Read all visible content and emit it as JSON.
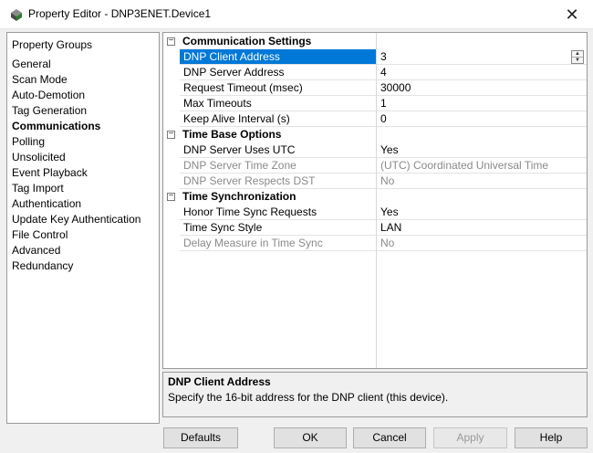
{
  "window": {
    "title": "Property Editor - DNP3ENET.Device1",
    "close_glyph": "✕"
  },
  "left_pane": {
    "header": "Property Groups",
    "items": [
      {
        "label": "General",
        "selected": false
      },
      {
        "label": "Scan Mode",
        "selected": false
      },
      {
        "label": "Auto-Demotion",
        "selected": false
      },
      {
        "label": "Tag Generation",
        "selected": false
      },
      {
        "label": "Communications",
        "selected": true
      },
      {
        "label": "Polling",
        "selected": false
      },
      {
        "label": "Unsolicited",
        "selected": false
      },
      {
        "label": "Event Playback",
        "selected": false
      },
      {
        "label": "Tag Import",
        "selected": false
      },
      {
        "label": "Authentication",
        "selected": false
      },
      {
        "label": "Update Key Authentication",
        "selected": false
      },
      {
        "label": "File Control",
        "selected": false
      },
      {
        "label": "Advanced",
        "selected": false
      },
      {
        "label": "Redundancy",
        "selected": false
      }
    ]
  },
  "grid": {
    "categories": [
      {
        "label": "Communication Settings",
        "toggle": "−",
        "properties": [
          {
            "name": "DNP Client Address",
            "value": "3",
            "selected": true
          },
          {
            "name": "DNP Server Address",
            "value": "4"
          },
          {
            "name": "Request Timeout (msec)",
            "value": "30000"
          },
          {
            "name": "Max Timeouts",
            "value": "1"
          },
          {
            "name": "Keep Alive Interval (s)",
            "value": "0"
          }
        ]
      },
      {
        "label": "Time Base Options",
        "toggle": "−",
        "properties": [
          {
            "name": "DNP Server Uses UTC",
            "value": "Yes"
          },
          {
            "name": "DNP Server Time Zone",
            "value": "(UTC) Coordinated Universal Time",
            "disabled": true
          },
          {
            "name": "DNP Server Respects DST",
            "value": "No",
            "disabled": true
          }
        ]
      },
      {
        "label": "Time Synchronization",
        "toggle": "−",
        "properties": [
          {
            "name": "Honor Time Sync Requests",
            "value": "Yes"
          },
          {
            "name": "Time Sync Style",
            "value": "LAN"
          },
          {
            "name": "Delay Measure in Time Sync",
            "value": "No",
            "disabled": true
          }
        ]
      }
    ]
  },
  "help": {
    "title": "DNP Client Address",
    "description": "Specify the 16-bit address for the DNP client (this device)."
  },
  "buttons": {
    "defaults": "Defaults",
    "ok": "OK",
    "cancel": "Cancel",
    "apply": "Apply",
    "help": "Help"
  },
  "colors": {
    "selection": "#0078d7",
    "disabled_text": "#8a8a8a"
  }
}
